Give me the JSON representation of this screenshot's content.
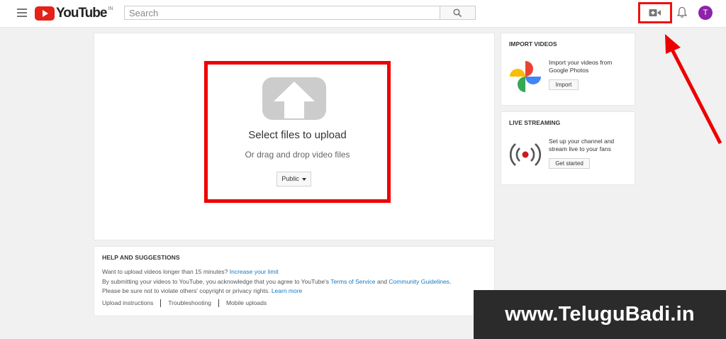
{
  "header": {
    "logo_text": "YouTube",
    "logo_country": "IN",
    "search_placeholder": "Search",
    "avatar_initial": "T"
  },
  "upload": {
    "title": "Select files to upload",
    "subtitle": "Or drag and drop video files",
    "privacy_selected": "Public"
  },
  "help": {
    "title": "HELP AND SUGGESTIONS",
    "line1_text": "Want to upload videos longer than 15 minutes?",
    "line1_link": "Increase your limit",
    "line2_text": "By submitting your videos to YouTube, you acknowledge that you agree to YouTube's",
    "line2_link1": "Terms of Service",
    "line2_and": "and",
    "line2_link2": "Community Guidelines",
    "line2_end": ".",
    "line3_text": "Please be sure not to violate others' copyright or privacy rights.",
    "line3_link": "Learn more",
    "links": [
      "Upload instructions",
      "Troubleshooting",
      "Mobile uploads"
    ]
  },
  "import": {
    "title": "IMPORT VIDEOS",
    "text": "Import your videos from Google Photos",
    "button": "Import"
  },
  "live": {
    "title": "LIVE STREAMING",
    "text": "Set up your channel and stream live to your fans",
    "button": "Get started"
  },
  "watermark": "www.TeluguBadi.in",
  "colors": {
    "brand_red": "#e62117",
    "highlight_red": "#ee0000",
    "link_blue": "#167ac6",
    "avatar_purple": "#8e24aa"
  },
  "icons": {
    "menu": "hamburger-icon",
    "search": "search-icon",
    "create": "video-camera-plus-icon",
    "notifications": "bell-icon",
    "import": "google-photos-icon",
    "live": "live-broadcast-icon"
  }
}
